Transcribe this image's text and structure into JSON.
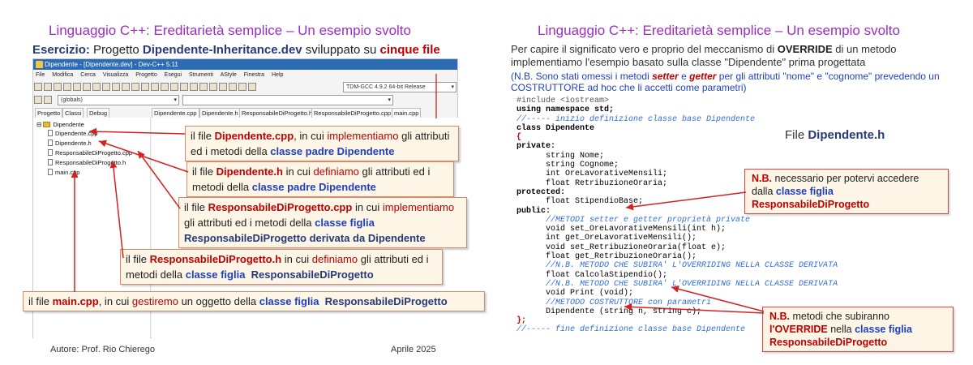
{
  "left": {
    "title": "Linguaggio C++: Ereditarietà semplice – Un esempio svolto",
    "exercise_label": "Esercizio:",
    "exercise_text1": " Progetto ",
    "exercise_project": "Dipendente-Inheritance.dev",
    "exercise_text2": " sviluppato su ",
    "exercise_files": "cinque file",
    "ide": {
      "window_title": "Dipendente - [Dipendente.dev] - Dev-C++ 5.11",
      "menu": [
        "File",
        "Modifica",
        "Cerca",
        "Visualizza",
        "Progetto",
        "Esegui",
        "Strumenti",
        "AStyle",
        "Finestra",
        "Help"
      ],
      "compiler": "TDM-GCC 4.9.2 64-bit Release",
      "globals": "(globals)",
      "panel_tabs": [
        "Progetto",
        "Classi",
        "Debug"
      ],
      "editor_tabs": [
        "Dipendente.cpp",
        "Dipendente.h",
        "ResponsabileDiProgetto.h",
        "ResponsabileDiProgetto.cpp",
        "main.cpp"
      ],
      "tree_root": "Dipendente",
      "tree_files": [
        "Dipendente.cpp",
        "Dipendente.h",
        "ResponsabileDiProgetto.cpp",
        "ResponsabileDiProgetto.h",
        "main.cpp"
      ]
    },
    "callouts": [
      {
        "p1": "il file ",
        "file": "Dipendente.cpp",
        "p2": ", in cui ",
        "verb": "implementiamo",
        "p3": " gli attributi ed i metodi della ",
        "cls": "classe padre Dipendente"
      },
      {
        "p1": "il file ",
        "file": "Dipendente.h",
        "p2": " in cui ",
        "verb": "definiamo",
        "p3": " gli attributi ed i metodi della ",
        "cls": "classe padre Dipendente"
      },
      {
        "p1": "il file ",
        "file": "ResponsabileDiProgetto.cpp",
        "p2": " in cui ",
        "verb": "implementiamo",
        "p3": " gli attributi ed i metodi della ",
        "cls": "classe figlia",
        "p4": " ResponsabileDiProgetto derivata da Dipendente"
      },
      {
        "p1": "il file ",
        "file": "ResponsabileDiProgetto.h",
        "p2": " in cui ",
        "verb": "definiamo",
        "p3": " gli attributi ed i metodi della ",
        "cls": "classe figlia",
        "p4": "ResponsabileDiProgetto"
      },
      {
        "p1": "il file ",
        "file": "main.cpp",
        "p2": ", in cui ",
        "verb": "gestiremo",
        "p3": " un oggetto della ",
        "cls": "classe figlia",
        "p4": "ResponsabileDiProgetto"
      }
    ],
    "author": "Autore: Prof. Rio Chierego",
    "date": "Aprile 2025"
  },
  "right": {
    "title": "Linguaggio C++: Ereditarietà semplice – Un esempio svolto",
    "intro1": "Per capire il significato vero e proprio del meccanismo di ",
    "override": "OVERRIDE",
    "intro2": " di un metodo implementiamo l'esempio basato sulla classe \"Dipendente\" prima progettata",
    "note1": "(N.B. Sono stati omessi i metodi ",
    "setter": "setter",
    "note2": " e ",
    "getter": "getter",
    "note3": " per gli attributi \"nome\" e \"cognome\" prevedendo un COSTRUTTORE ad hoc che li accetti come parametri)",
    "file_label": "File ",
    "file_name": "Dipendente.h",
    "code": [
      "#include <iostream>",
      "using namespace std;",
      "//----- inizio definizione classe base Dipendente",
      "class Dipendente",
      "{",
      "private:",
      "      string Nome;",
      "      string Cognome;",
      "      int OreLavorativeMensili;",
      "      float RetribuzioneOraria;",
      "protected:",
      "      float StipendioBase;",
      "public:",
      "      //METODI setter e getter proprietà private",
      "      void set_OreLavorativeMensili(int h);",
      "      int get_OreLavorativeMensili();",
      "      void set_RetribuzioneOraria(float e);",
      "      float get_RetribuzioneOraria();",
      "      //N.B. METODO CHE SUBIRA' L'OVERRIDING NELLA CLASSE DERIVATA",
      "      float CalcolaStipendio();",
      "      //N.B. METODO CHE SUBIRA' L'OVERRIDING NELLA CLASSE DERIVATA",
      "      void Print (void);",
      "      //METODO COSTRUTTORE con parametri",
      "      Dipendente (string n, string c);",
      "};",
      "//----- fine definizione classe base Dipendente"
    ],
    "callout_protected": {
      "nb": "N.B.",
      "t1": " necessario per potervi accedere dalla ",
      "cls": "classe figlia",
      "name": "ResponsabileDiProgetto"
    },
    "callout_override": {
      "nb": "N.B.",
      "t1": " metodi che subiranno ",
      "ov": "l'OVERRIDE",
      "t2": " nella ",
      "cls": "classe figlia",
      "name": "ResponsabileDiProgetto"
    }
  },
  "colors": {
    "title": "#9b2fbf",
    "accent_red": "#c00000",
    "accent_blue": "#1f3fbf",
    "comment": "#2f6fd6",
    "callout_bg": "#fdf5e6"
  }
}
